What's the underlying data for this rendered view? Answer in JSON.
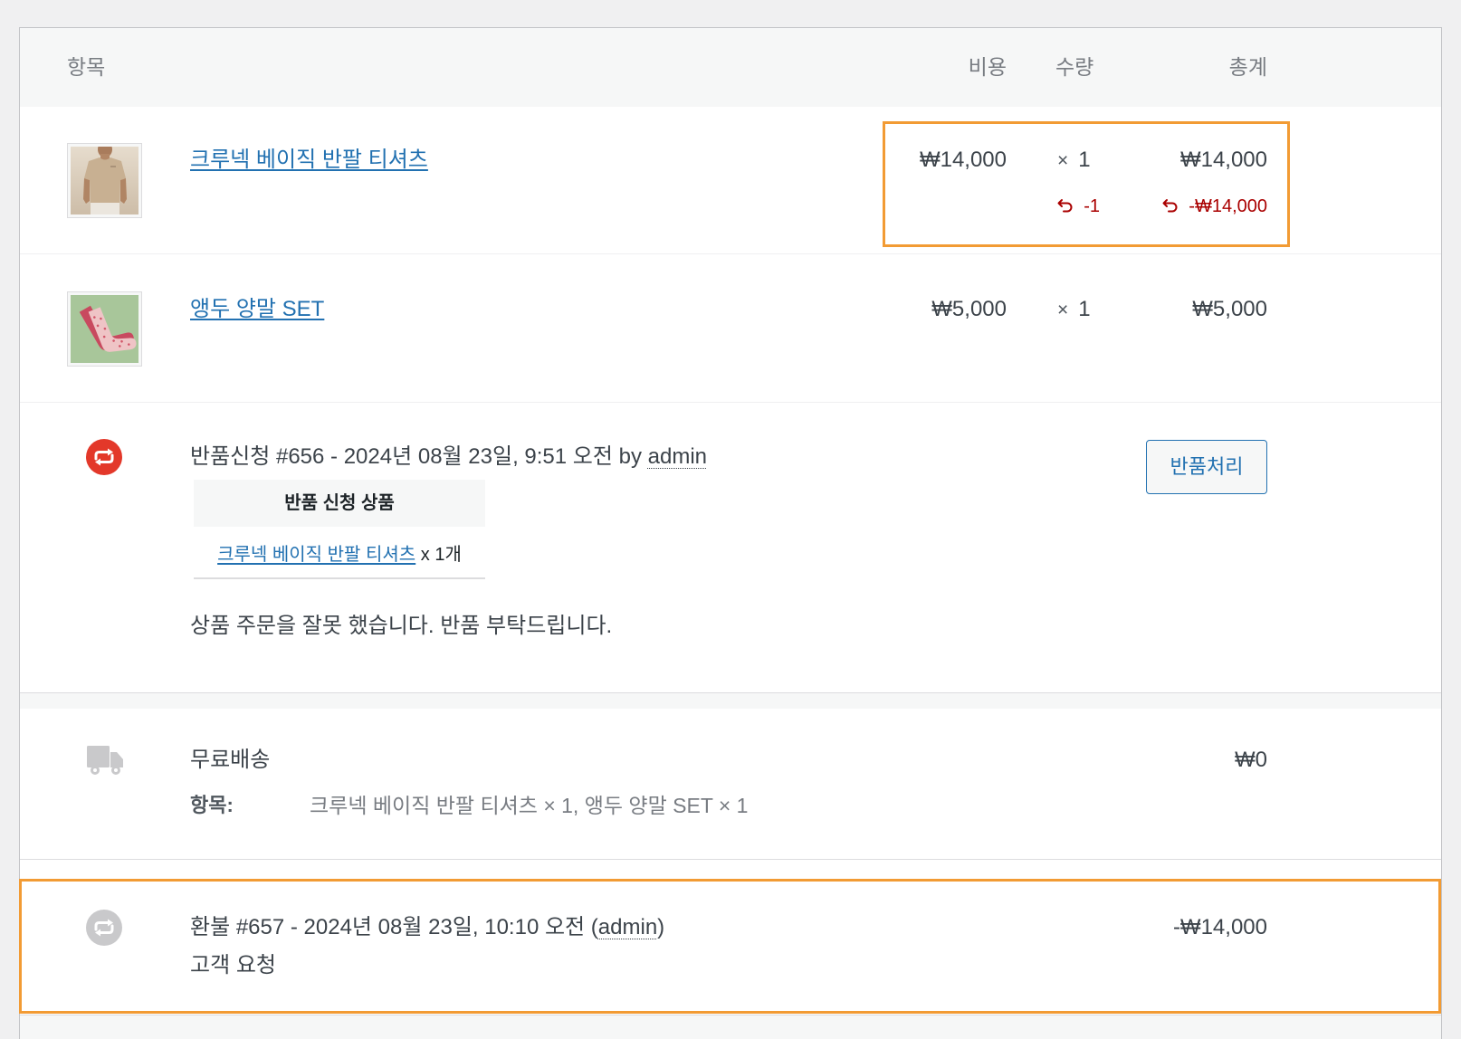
{
  "colors": {
    "link": "#2271b1",
    "refund": "#aa0000",
    "highlight": "#f29b34",
    "return_icon": "#e3382a",
    "muted_icon": "#c9c9cb"
  },
  "header": {
    "item": "항목",
    "cost": "비용",
    "qty": "수량",
    "total": "총계"
  },
  "items": [
    {
      "name": "크루넥 베이직 반팔 티셔츠",
      "cost": "₩14,000",
      "qty_sign": "×",
      "qty": "1",
      "total": "₩14,000",
      "refund_icon": "undo-icon",
      "refunded_qty": "-1",
      "refunded_total": "-₩14,000"
    },
    {
      "name": "앵두 양말 SET",
      "cost": "₩5,000",
      "qty_sign": "×",
      "qty": "1",
      "total": "₩5,000"
    }
  ],
  "return_request": {
    "icon": "return-request-icon",
    "title": "반품신청 #656 - 2024년 08월 23일, 9:51 오전 by",
    "author": "admin",
    "button": "반품처리",
    "table_header": "반품 신청 상품",
    "table_item": {
      "name": "크루넥 베이직 반팔 티셔츠",
      "qty": "x 1개"
    },
    "reason": "상품 주문을 잘못 했습니다. 반품 부탁드립니다."
  },
  "shipping": {
    "icon": "truck-icon",
    "method": "무료배송",
    "total": "₩0",
    "meta_label": "항목:",
    "meta_value": "크루넥 베이직 반팔 티셔츠 × 1, 앵두 양말 SET × 1"
  },
  "refund": {
    "icon": "refund-icon",
    "title": "환불 #657 - 2024년 08월 23일, 10:10 오전 (",
    "author": "admin",
    "title_end": ")",
    "reason": "고객 요청",
    "amount": "-₩14,000"
  }
}
